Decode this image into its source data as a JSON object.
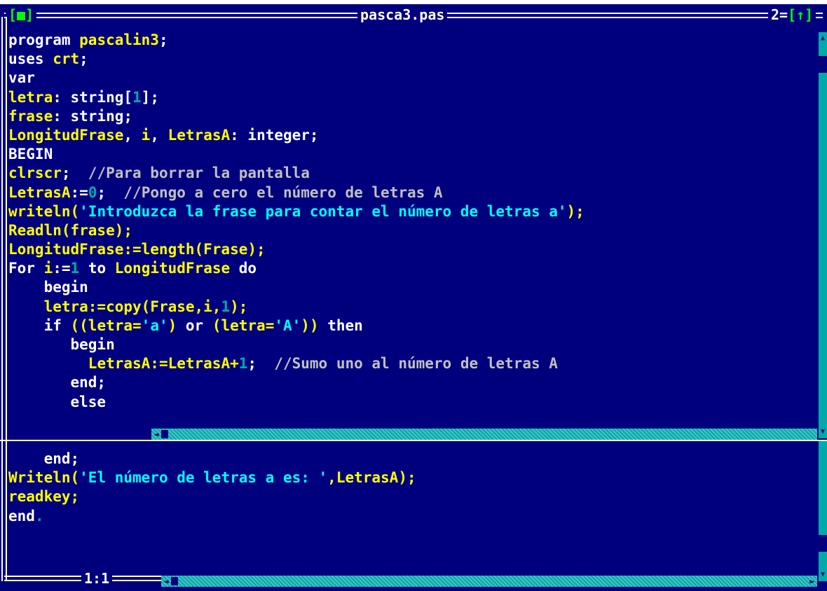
{
  "editor": {
    "title": "pasca3.pas",
    "close_box": "[■]",
    "window_number": "2=",
    "zoom_box": "[↑]",
    "cursor_position": "1:1"
  },
  "top_pane": {
    "lines": [
      [
        [
          "kw",
          "program "
        ],
        [
          "id",
          "pascalin3"
        ],
        [
          "kw",
          ";"
        ]
      ],
      [
        [
          "kw",
          "uses "
        ],
        [
          "id",
          "crt"
        ],
        [
          "kw",
          ";"
        ]
      ],
      [
        [
          "kw",
          "var"
        ]
      ],
      [
        [
          "id",
          "letra"
        ],
        [
          "kw",
          ": string["
        ],
        [
          "nm",
          "1"
        ],
        [
          "kw",
          "];"
        ]
      ],
      [
        [
          "id",
          "frase"
        ],
        [
          "kw",
          ": string;"
        ]
      ],
      [
        [
          "id",
          "LongitudFrase"
        ],
        [
          "kw",
          ", "
        ],
        [
          "id",
          "i"
        ],
        [
          "kw",
          ", "
        ],
        [
          "id",
          "LetrasA"
        ],
        [
          "kw",
          ": integer;"
        ]
      ],
      [
        [
          "kw",
          "BEGIN"
        ]
      ],
      [
        [
          "id",
          "clrscr"
        ],
        [
          "kw",
          ";  "
        ],
        [
          "cm",
          "//Para borrar la pantalla"
        ]
      ],
      [
        [
          "id",
          "LetrasA"
        ],
        [
          "kw",
          ":="
        ],
        [
          "nm",
          "0"
        ],
        [
          "kw",
          ";  "
        ],
        [
          "cm",
          "//Pongo a cero el número de letras A"
        ]
      ],
      [
        [
          "id",
          "writeln("
        ],
        [
          "st",
          "'Introduzca la frase para contar el número de letras a'"
        ],
        [
          "id",
          ");"
        ]
      ],
      [
        [
          "id",
          "Readln(frase);"
        ]
      ],
      [
        [
          "id",
          "LongitudFrase:=length(Frase);"
        ]
      ],
      [
        [
          "kw",
          "For "
        ],
        [
          "id",
          "i"
        ],
        [
          "kw",
          ":="
        ],
        [
          "nm",
          "1"
        ],
        [
          "kw",
          " to "
        ],
        [
          "id",
          "LongitudFrase"
        ],
        [
          "kw",
          " do"
        ]
      ],
      [
        [
          "kw",
          "    begin"
        ]
      ],
      [
        [
          "kw",
          "    "
        ],
        [
          "id",
          "letra:=copy(Frase,i,"
        ],
        [
          "nm",
          "1"
        ],
        [
          "id",
          ");"
        ]
      ],
      [
        [
          "kw",
          "    if "
        ],
        [
          "id",
          "((letra="
        ],
        [
          "st",
          "'a'"
        ],
        [
          "id",
          ") "
        ],
        [
          "kw",
          "or "
        ],
        [
          "id",
          "(letra="
        ],
        [
          "st",
          "'A'"
        ],
        [
          "id",
          "))"
        ],
        [
          "kw",
          " then"
        ]
      ],
      [
        [
          "kw",
          "       begin"
        ]
      ],
      [
        [
          "kw",
          "         "
        ],
        [
          "id",
          "LetrasA:=LetrasA+"
        ],
        [
          "nm",
          "1"
        ],
        [
          "kw",
          ";  "
        ],
        [
          "cm",
          "//Sumo uno al número de letras A"
        ]
      ],
      [
        [
          "kw",
          "       end;"
        ]
      ],
      [
        [
          "kw",
          "       else"
        ]
      ]
    ]
  },
  "bottom_pane": {
    "lines": [
      [
        [
          "kw",
          "    end;"
        ]
      ],
      [
        [
          "id",
          "Writeln("
        ],
        [
          "st",
          "'El número de letras a es: '"
        ],
        [
          "id",
          ",LetrasA);"
        ]
      ],
      [
        [
          "id",
          "readkey;"
        ]
      ],
      [
        [
          "kw",
          "end"
        ],
        [
          "nm",
          "."
        ]
      ]
    ]
  },
  "colors": {
    "background": "#00007f",
    "frame": "#ffffff",
    "identifier": "#ffff00",
    "string": "#00ffff",
    "comment": "#c0c0c0",
    "number": "#00aaaa",
    "scrollbar": "#00aaaa"
  },
  "icons": {
    "close": "close-box-icon",
    "zoom": "zoom-arrow-icon",
    "scroll_up": "arrow-up-icon",
    "scroll_down": "arrow-down-icon",
    "scroll_left": "arrow-left-icon",
    "scroll_right": "arrow-right-icon"
  }
}
